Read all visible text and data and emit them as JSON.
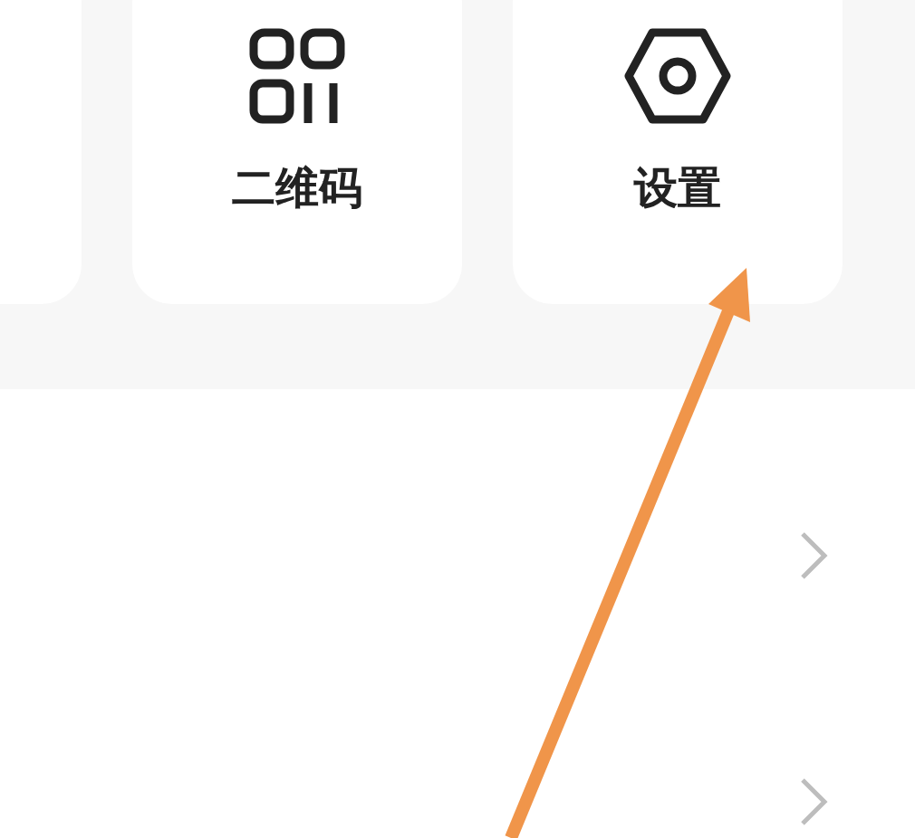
{
  "shortcuts": [
    {
      "kind": "cut"
    },
    {
      "kind": "qr",
      "label": "二维码"
    },
    {
      "kind": "settings",
      "label": "设置"
    }
  ],
  "list_rows": [
    {
      "kind": "chevron"
    },
    {
      "kind": "chevron"
    }
  ]
}
